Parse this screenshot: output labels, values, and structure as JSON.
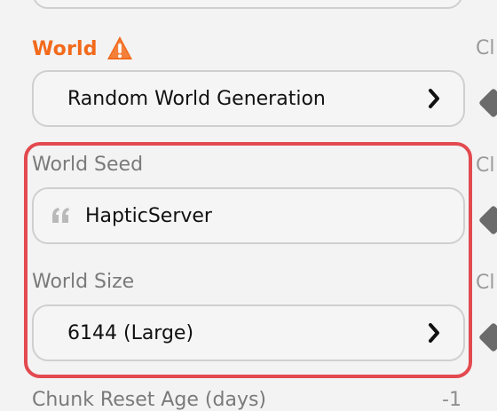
{
  "world": {
    "title": "World",
    "generation_label": "Random World Generation",
    "seed_label": "World Seed",
    "seed_value": "HapticServer",
    "size_label": "World Size",
    "size_value": "6144 (Large)"
  },
  "right_column": {
    "ghost_text": "Cl"
  },
  "bottom": {
    "label": "Chunk Reset Age (days)",
    "value": "-1"
  },
  "colors": {
    "accent": "#f26a1b",
    "highlight": "#e24a4f"
  },
  "icons": {
    "warning": "warning-icon",
    "chevron": "chevron-right-icon",
    "quote": "quote-icon"
  }
}
